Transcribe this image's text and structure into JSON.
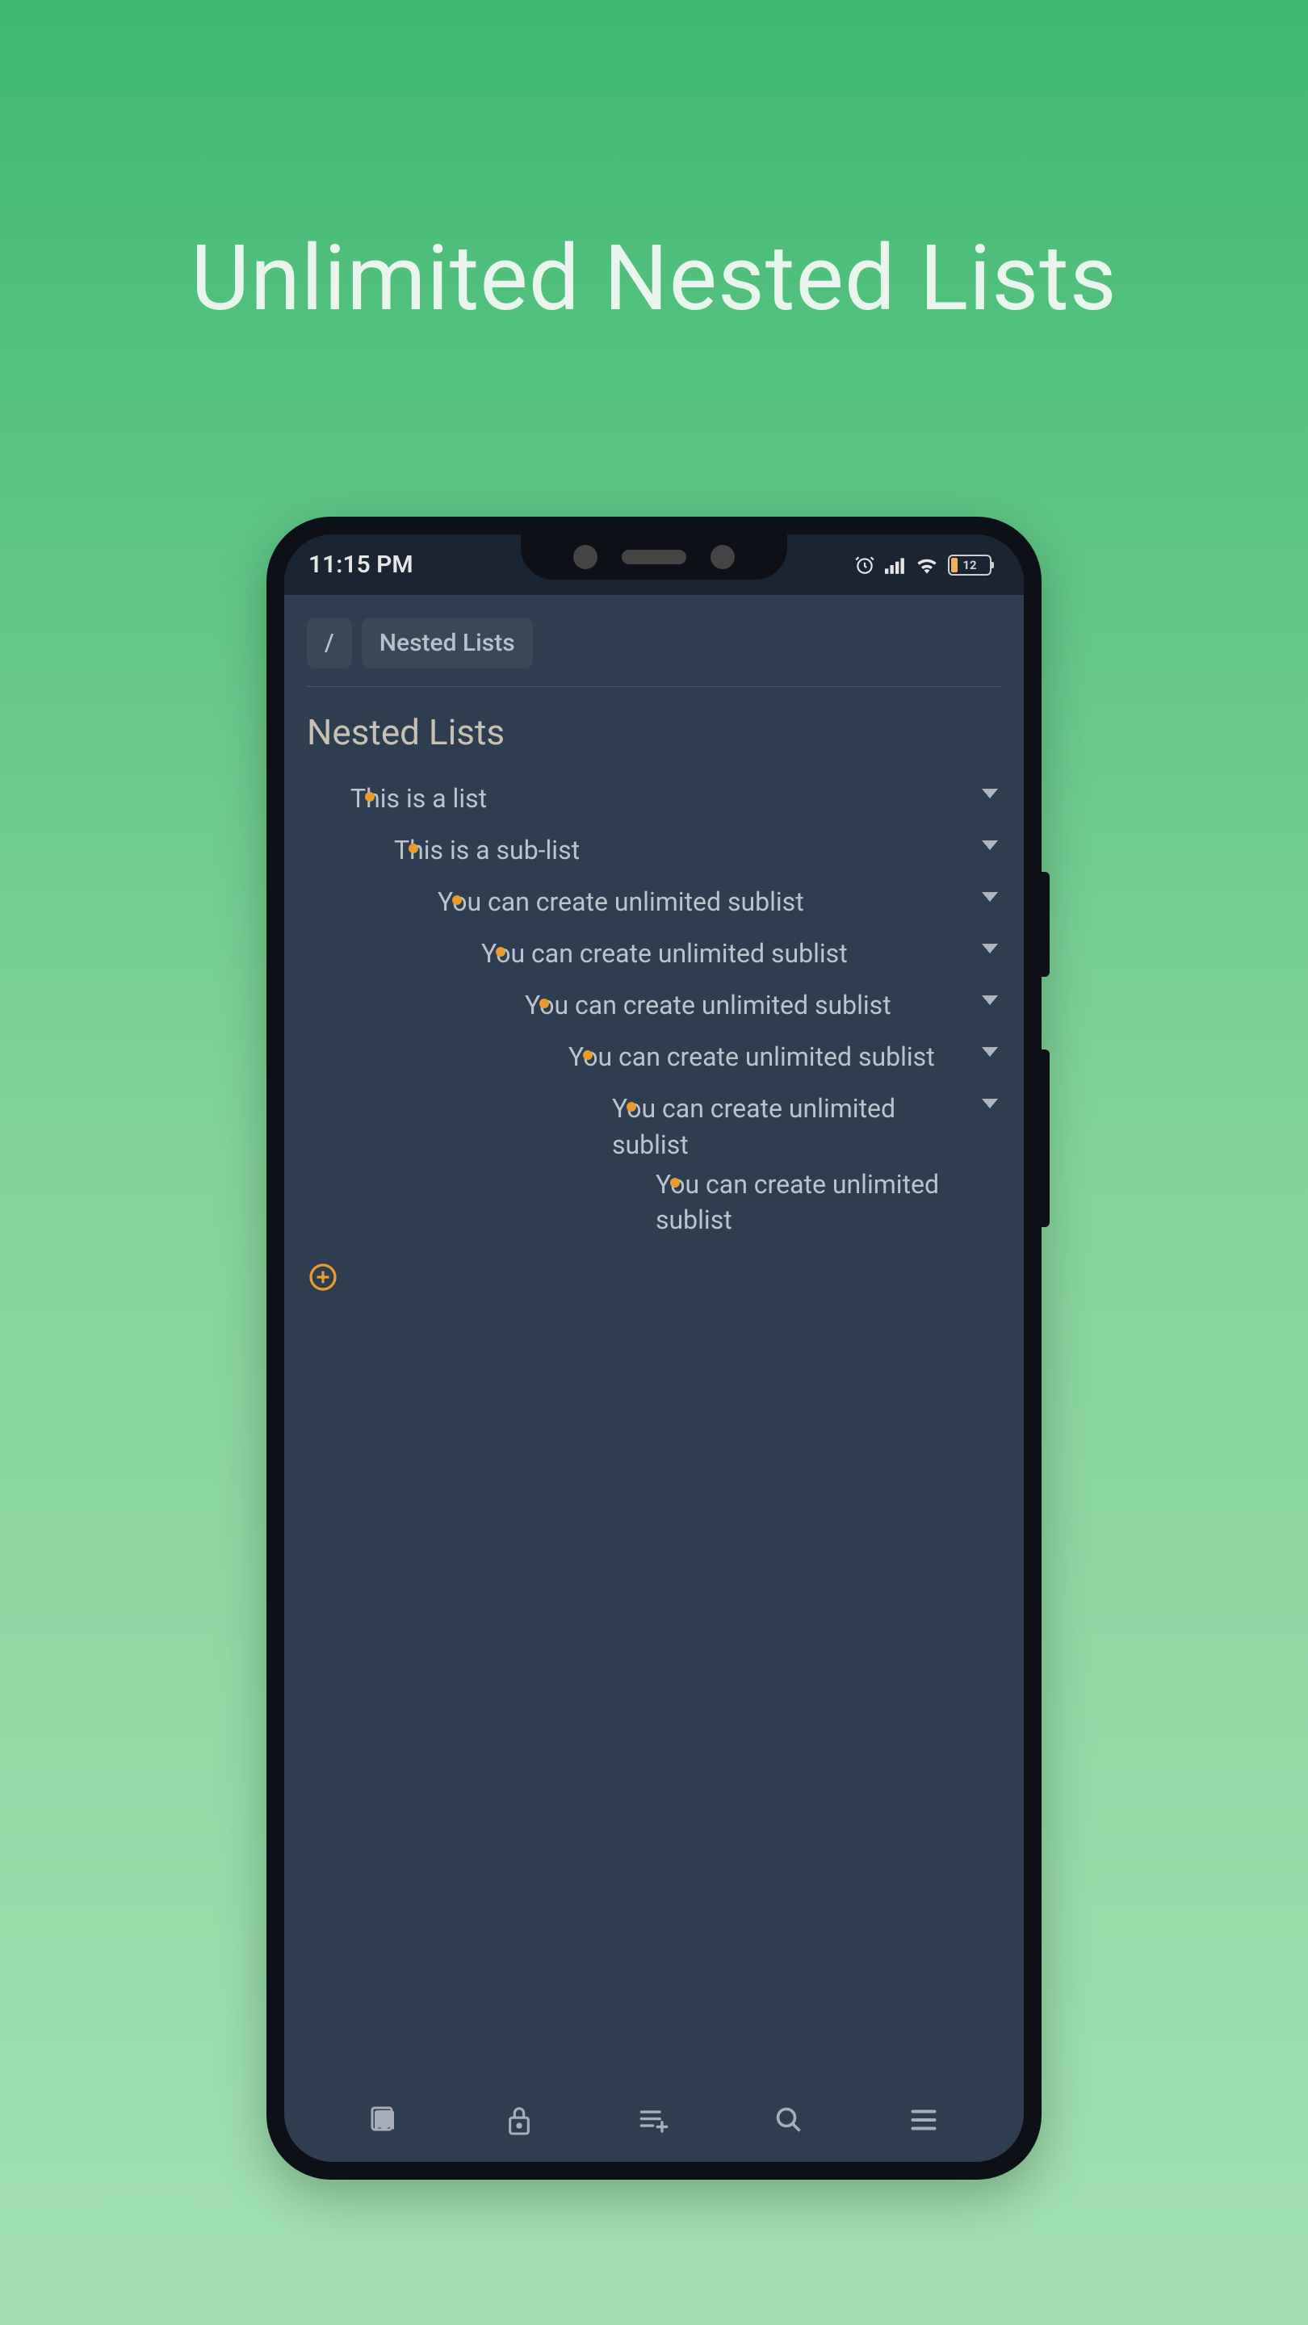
{
  "marketing_title": "Unlimited Nested Lists",
  "statusbar": {
    "time": "11:15 PM",
    "battery_pct": "12"
  },
  "breadcrumb": {
    "root": "/",
    "current": "Nested Lists"
  },
  "page": {
    "title": "Nested Lists"
  },
  "list": {
    "items": [
      {
        "text": "This is a list",
        "children": [
          {
            "text": "This is a sub-list",
            "children": [
              {
                "text": "You can create unlimited sublist",
                "children": [
                  {
                    "text": "You can create unlimited sublist",
                    "children": [
                      {
                        "text": "You can create unlimited sublist",
                        "children": [
                          {
                            "text": "You can create unlimited sublist",
                            "children": [
                              {
                                "text": "You can create unlimited sublist",
                                "children": [
                                  {
                                    "text": "You can create unlimited sublist",
                                    "children": []
                                  }
                                ]
                              }
                            ]
                          }
                        ]
                      }
                    ]
                  }
                ]
              }
            ]
          }
        ]
      }
    ]
  },
  "colors": {
    "accent": "#e79c2e",
    "app_bg": "#2f3d50"
  }
}
